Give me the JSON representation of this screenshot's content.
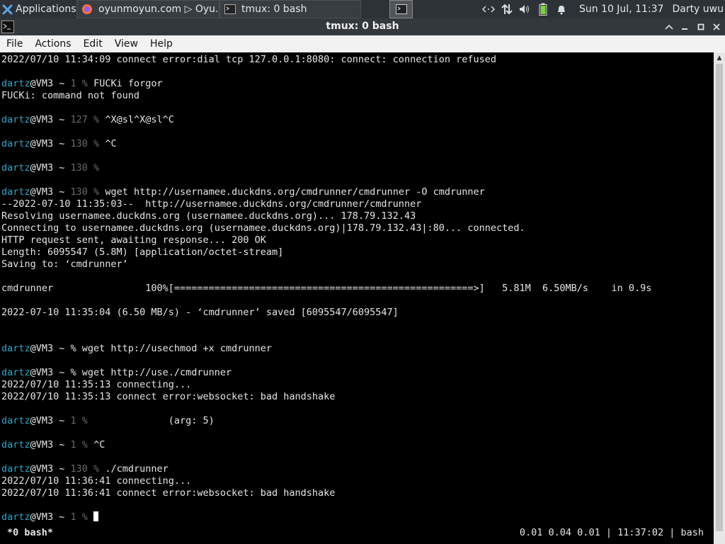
{
  "panel": {
    "applications": "Applications",
    "firefox_task": "oyunmoyun.com ▷ Oyu...",
    "terminal_task": "tmux: 0 bash",
    "clock": "Sun 10 Jul, 11:37",
    "user": "Darty uwu"
  },
  "window": {
    "title": "tmux: 0 bash"
  },
  "menubar": {
    "file": "File",
    "actions": "Actions",
    "edit": "Edit",
    "view": "View",
    "help": "Help"
  },
  "terminal": {
    "lines": [
      [
        {
          "t": "2022/07/10 11:34:09 connect error:dial tcp 127.0.0.1:8080: connect: connection refused"
        }
      ],
      [],
      [
        {
          "t": "dartz",
          "c": "u"
        },
        {
          "t": "@VM3 ~ "
        },
        {
          "t": "1 %",
          "c": "g"
        },
        {
          "t": " FUCKi forgor"
        }
      ],
      [
        {
          "t": "FUCKi: command not found"
        }
      ],
      [],
      [
        {
          "t": "dartz",
          "c": "u"
        },
        {
          "t": "@VM3 ~ "
        },
        {
          "t": "127 %",
          "c": "g"
        },
        {
          "t": " ^X@sl^X@sl^C"
        }
      ],
      [],
      [
        {
          "t": "dartz",
          "c": "u"
        },
        {
          "t": "@VM3 ~ "
        },
        {
          "t": "130 %",
          "c": "g"
        },
        {
          "t": " ^C"
        }
      ],
      [],
      [
        {
          "t": "dartz",
          "c": "u"
        },
        {
          "t": "@VM3 ~ "
        },
        {
          "t": "130 %",
          "c": "g"
        }
      ],
      [],
      [
        {
          "t": "dartz",
          "c": "u"
        },
        {
          "t": "@VM3 ~ "
        },
        {
          "t": "130 %",
          "c": "g"
        },
        {
          "t": " wget http://usernamee.duckdns.org/cmdrunner/cmdrunner -O cmdrunner"
        }
      ],
      [
        {
          "t": "--2022-07-10 11:35:03--  http://usernamee.duckdns.org/cmdrunner/cmdrunner"
        }
      ],
      [
        {
          "t": "Resolving usernamee.duckdns.org (usernamee.duckdns.org)... 178.79.132.43"
        }
      ],
      [
        {
          "t": "Connecting to usernamee.duckdns.org (usernamee.duckdns.org)|178.79.132.43|:80... connected."
        }
      ],
      [
        {
          "t": "HTTP request sent, awaiting response... 200 OK"
        }
      ],
      [
        {
          "t": "Length: 6095547 (5.8M) [application/octet-stream]"
        }
      ],
      [
        {
          "t": "Saving to: ‘cmdrunner’"
        }
      ],
      [],
      [
        {
          "t": "cmdrunner                100%[====================================================>]   5.81M  6.50MB/s    in 0.9s"
        }
      ],
      [],
      [
        {
          "t": "2022-07-10 11:35:04 (6.50 MB/s) - ‘cmdrunner’ saved [6095547/6095547]"
        }
      ],
      [],
      [],
      [
        {
          "t": "dartz",
          "c": "u"
        },
        {
          "t": "@VM3 ~ % wget http://usechmod +x cmdrunner"
        }
      ],
      [],
      [
        {
          "t": "dartz",
          "c": "u"
        },
        {
          "t": "@VM3 ~ % wget http://use./cmdrunner"
        }
      ],
      [
        {
          "t": "2022/07/10 11:35:13 connecting..."
        }
      ],
      [
        {
          "t": "2022/07/10 11:35:13 connect error:websocket: bad handshake"
        }
      ],
      [],
      [
        {
          "t": "dartz",
          "c": "u"
        },
        {
          "t": "@VM3 ~ "
        },
        {
          "t": "1 %",
          "c": "g"
        },
        {
          "t": "              (arg: 5)"
        }
      ],
      [],
      [
        {
          "t": "dartz",
          "c": "u"
        },
        {
          "t": "@VM3 ~ "
        },
        {
          "t": "1 %",
          "c": "g"
        },
        {
          "t": " ^C"
        }
      ],
      [],
      [
        {
          "t": "dartz",
          "c": "u"
        },
        {
          "t": "@VM3 ~ "
        },
        {
          "t": "130 %",
          "c": "g"
        },
        {
          "t": " ./cmdrunner"
        }
      ],
      [
        {
          "t": "2022/07/10 11:36:41 connecting..."
        }
      ],
      [
        {
          "t": "2022/07/10 11:36:41 connect error:websocket: bad handshake"
        }
      ],
      [],
      [
        {
          "t": "dartz",
          "c": "u"
        },
        {
          "t": "@VM3 ~ "
        },
        {
          "t": "1 %",
          "c": "g"
        },
        {
          "t": " "
        },
        {
          "cursor": true
        }
      ]
    ],
    "status_left": "*0 bash*",
    "status_right": "0.01 0.04 0.01 | 11:37:02 | bash"
  },
  "colors": {
    "prompt_user": "#2aa9c9",
    "prompt_dim": "#6a6a6a",
    "terminal_bg": "#000000"
  },
  "icons": [
    "xfce-logo-icon",
    "firefox-icon",
    "terminal-icon",
    "network-icon",
    "transfer-icon",
    "volume-icon",
    "battery-icon",
    "notification-bell-icon"
  ]
}
